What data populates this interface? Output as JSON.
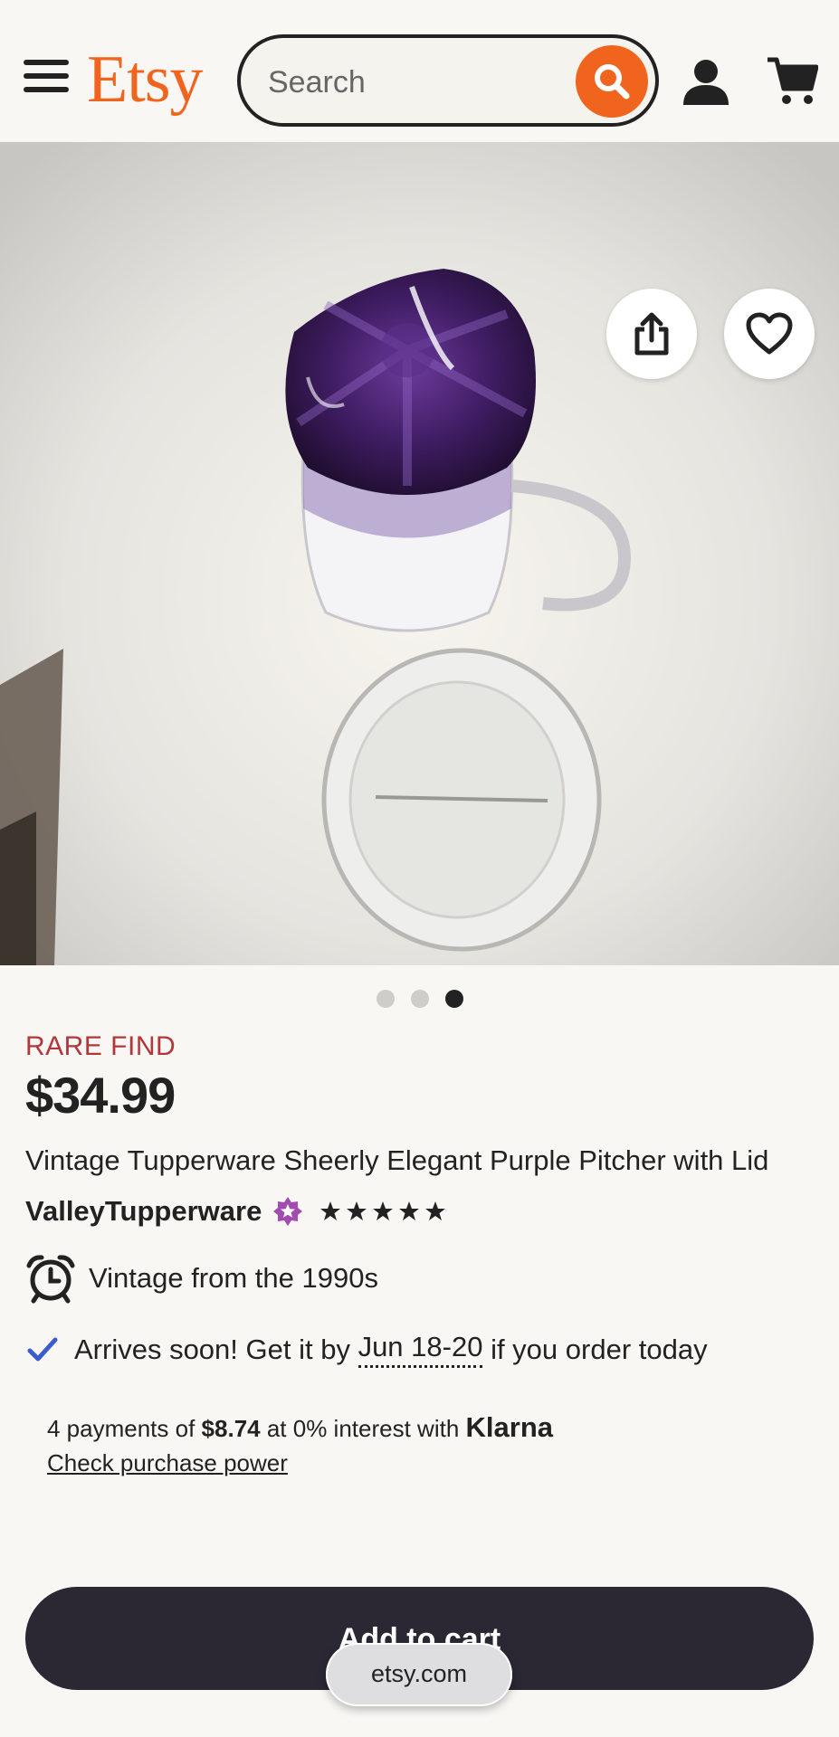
{
  "header": {
    "logo": "Etsy",
    "search_placeholder": "Search",
    "menu_icon": "hamburger-menu-icon",
    "search_icon": "magnifier-icon",
    "user_icon": "user-icon",
    "cart_icon": "cart-icon"
  },
  "gallery": {
    "image_count": 3,
    "active_index": 3
  },
  "product": {
    "badge": "RARE FIND",
    "price": "$34.99",
    "title": "Vintage Tupperware Sheerly Elegant Purple Pitcher with Lid",
    "seller": "ValleyTupperware",
    "rating_stars": 5,
    "vintage": "Vintage from the 1990s"
  },
  "delivery": {
    "prefix": "Arrives soon! Get it by ",
    "dates": "Jun 18-20",
    "suffix": " if you order today"
  },
  "klarna": {
    "prefix": "4 payments of ",
    "amount": "$8.74",
    "middle": " at 0% interest with ",
    "brand": "Klarna",
    "link": "Check purchase power"
  },
  "cta": {
    "add_to_cart": "Add to cart"
  },
  "browser": {
    "url": "etsy.com"
  },
  "colors": {
    "brand_orange": "#f1641e",
    "rare_red": "#b1373a",
    "dark_button": "#2b2733",
    "star_seller_purple": "#a24bb0",
    "check_blue": "#3b5ccc"
  }
}
